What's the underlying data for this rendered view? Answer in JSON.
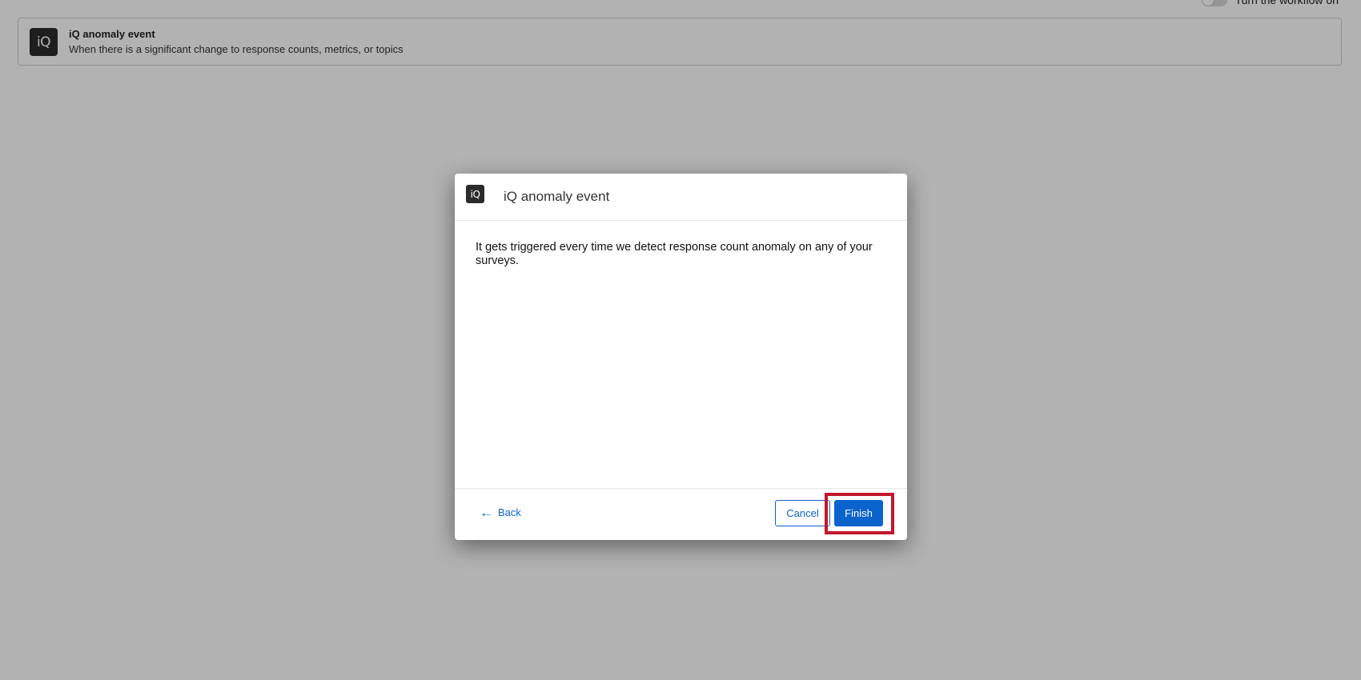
{
  "background": {
    "toggle": {
      "label": "Turn the workflow on",
      "state": "off"
    },
    "event_card": {
      "icon": "iq-logo",
      "logo_text": "iQ",
      "title": "iQ anomaly event",
      "description": "When there is a significant change to response counts, metrics, or topics"
    }
  },
  "modal": {
    "icon": "iq-logo",
    "logo_text": "iQ",
    "title": "iQ anomaly event",
    "body": "It gets triggered every time we detect response count anomaly on any of your surveys.",
    "footer": {
      "back_icon": "arrow-left-icon",
      "back_arrow": "←",
      "back_label": "Back",
      "cancel_label": "Cancel",
      "finish_label": "Finish"
    }
  },
  "colors": {
    "accent": "#0b63ce",
    "highlight": "#c3162b",
    "logo_bg": "#2b2b2b"
  }
}
